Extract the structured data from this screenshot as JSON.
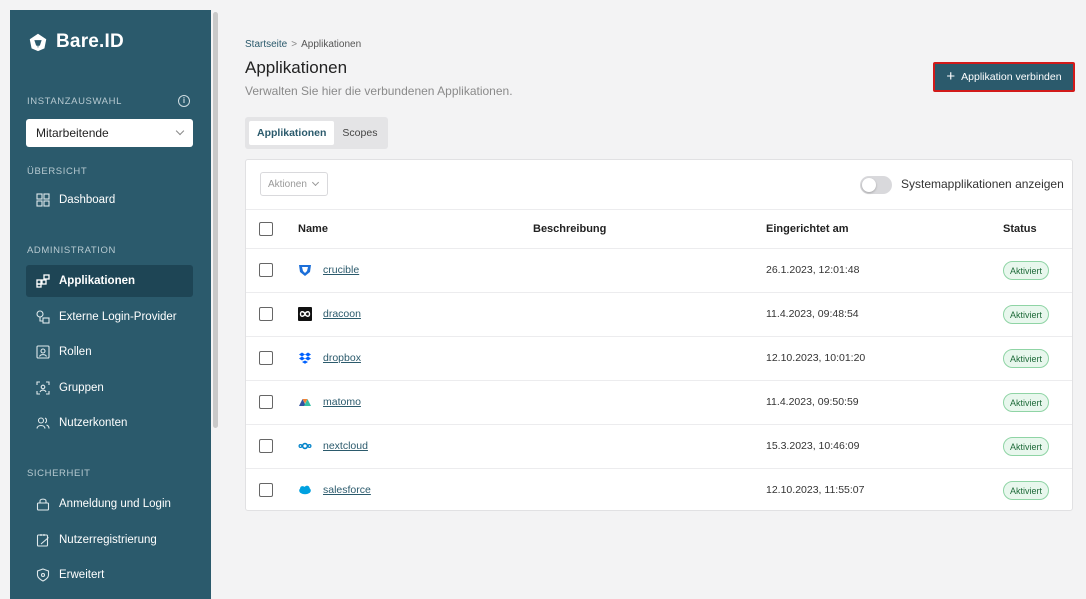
{
  "sidebar": {
    "brand": "Bare.ID",
    "instance_label": "INSTANZAUSWAHL",
    "instance_value": "Mitarbeitende",
    "sections": {
      "overview": "ÜBERSICHT",
      "administration": "ADMINISTRATION",
      "security": "SICHERHEIT"
    },
    "items": [
      {
        "label": "Dashboard",
        "icon": "dashboard-icon"
      },
      {
        "label": "Applikationen",
        "icon": "applications-icon"
      },
      {
        "label": "Externe Login-Provider",
        "icon": "key-icon"
      },
      {
        "label": "Rollen",
        "icon": "roles-icon"
      },
      {
        "label": "Gruppen",
        "icon": "groups-icon"
      },
      {
        "label": "Nutzerkonten",
        "icon": "users-icon"
      },
      {
        "label": "Anmeldung und Login",
        "icon": "lock-icon"
      },
      {
        "label": "Nutzerregistrierung",
        "icon": "registration-icon"
      },
      {
        "label": "Erweitert",
        "icon": "shield-icon"
      }
    ]
  },
  "header": {
    "breadcrumb": [
      "Startseite",
      "Applikationen"
    ],
    "breadcrumb_sep": ">",
    "title": "Applikationen",
    "subtitle": "Verwalten Sie hier die verbundenen Applikationen.",
    "primary_button": "Applikation verbinden"
  },
  "tabs": [
    "Applikationen",
    "Scopes"
  ],
  "toolbar": {
    "actions_label": "Aktionen",
    "toggle_label": "Systemapplikationen anzeigen"
  },
  "table": {
    "columns": [
      "Name",
      "Beschreibung",
      "Eingerichtet am",
      "Status"
    ],
    "rows": [
      {
        "name": "crucible",
        "description": "",
        "created": "26.1.2023, 12:01:48",
        "status": "Aktiviert",
        "icon": "crucible-icon"
      },
      {
        "name": "dracoon",
        "description": "",
        "created": "11.4.2023, 09:48:54",
        "status": "Aktiviert",
        "icon": "dracoon-icon"
      },
      {
        "name": "dropbox",
        "description": "",
        "created": "12.10.2023, 10:01:20",
        "status": "Aktiviert",
        "icon": "dropbox-icon"
      },
      {
        "name": "matomo",
        "description": "",
        "created": "11.4.2023, 09:50:59",
        "status": "Aktiviert",
        "icon": "matomo-icon"
      },
      {
        "name": "nextcloud",
        "description": "",
        "created": "15.3.2023, 10:46:09",
        "status": "Aktiviert",
        "icon": "nextcloud-icon"
      },
      {
        "name": "salesforce",
        "description": "",
        "created": "12.10.2023, 11:55:07",
        "status": "Aktiviert",
        "icon": "salesforce-icon"
      }
    ]
  },
  "colors": {
    "sidebar": "#2b5a6c",
    "sidebar_active": "#1e4555",
    "accent": "#2b5a6c",
    "highlight_border": "#d21a1a",
    "status_green": "#1f6b3a"
  }
}
